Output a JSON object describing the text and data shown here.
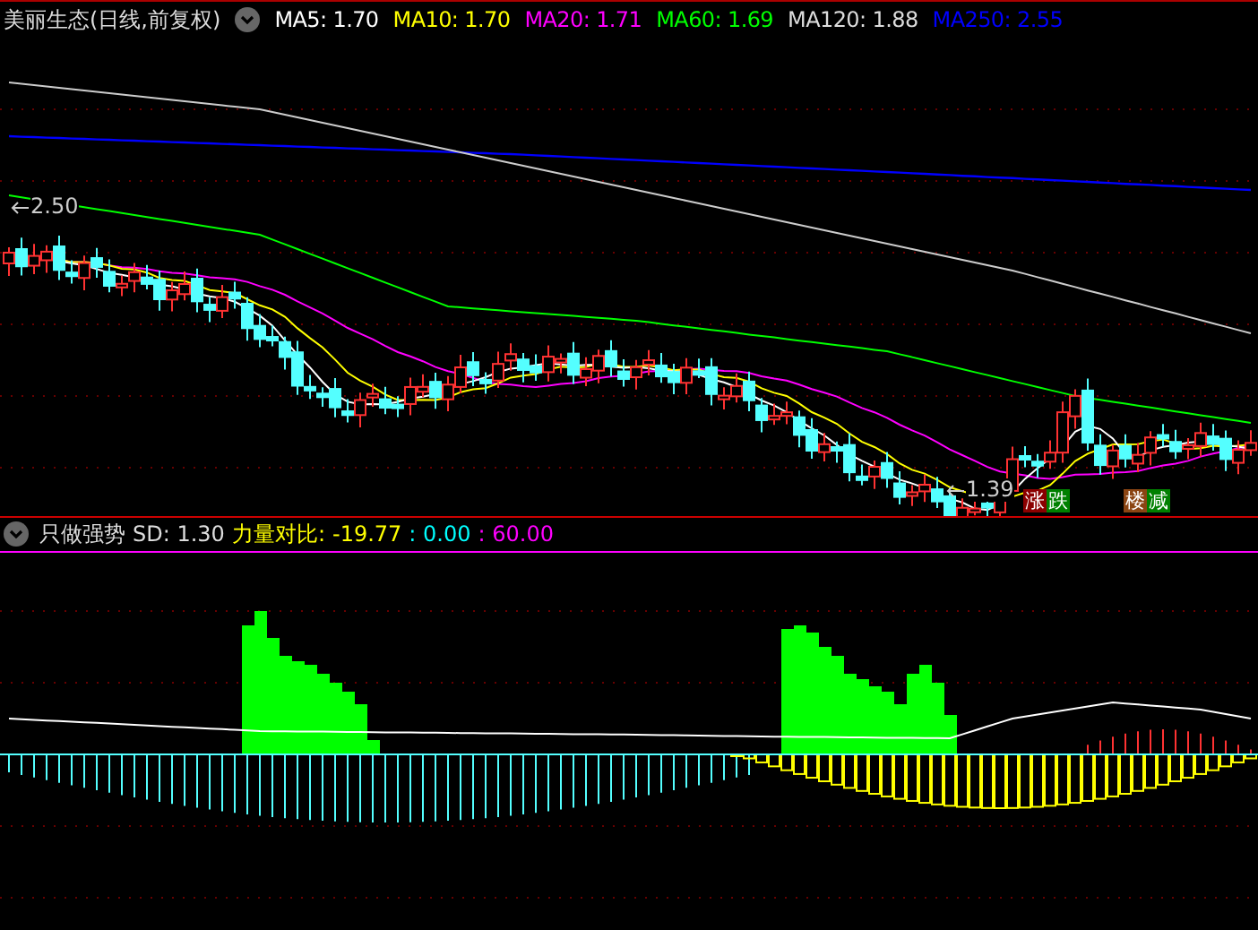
{
  "stock_title": "美丽生态(日线,前复权)",
  "ma_legend": [
    {
      "label": "MA5: 1.70",
      "color": "#ffffff"
    },
    {
      "label": "MA10: 1.70",
      "color": "#ffff00"
    },
    {
      "label": "MA20: 1.71",
      "color": "#ff00ff"
    },
    {
      "label": "MA60: 1.69",
      "color": "#00ff00"
    },
    {
      "label": "MA120: 1.88",
      "color": "#dddddd"
    },
    {
      "label": "MA250: 2.55",
      "color": "#0000ff"
    }
  ],
  "price_labels": [
    {
      "kind": "high",
      "text": "2.50"
    },
    {
      "kind": "low",
      "text": "1.39"
    }
  ],
  "signal_badges": [
    {
      "chars": [
        {
          "text": "涨",
          "color": "#8b0000"
        },
        {
          "text": "跌",
          "color": "#008000"
        }
      ]
    },
    {
      "chars": [
        {
          "text": "楼",
          "color": "#8b4513"
        },
        {
          "text": "减",
          "color": "#008000"
        }
      ]
    }
  ],
  "indicator_title": "只做强势",
  "indicator_values": [
    {
      "text": "SD: 1.30",
      "color": "#dddddd"
    },
    {
      "text": "力量对比:",
      "color": "#ffff00"
    },
    {
      "text": "-19.77",
      "color": "#ffff00"
    },
    {
      "text": ": 0.00",
      "color": "#00ffff"
    },
    {
      "text": ": 60.00",
      "color": "#ff00ff"
    }
  ]
}
